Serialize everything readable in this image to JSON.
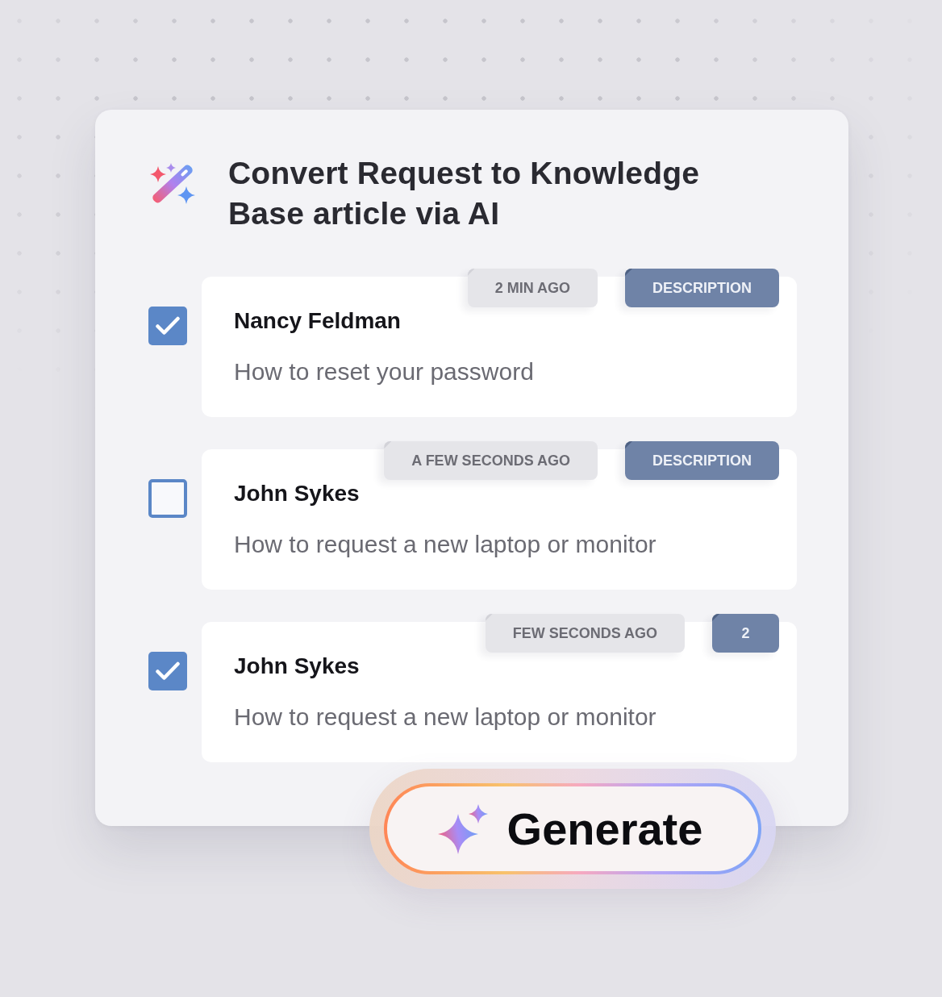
{
  "header": {
    "title": "Convert Request to Knowledge Base article via AI"
  },
  "requests": [
    {
      "checked": true,
      "name": "Nancy Feldman",
      "summary": "How to reset your password",
      "badges": [
        {
          "kind": "time",
          "text": "2 MIN AGO"
        },
        {
          "kind": "field",
          "text": "DESCRIPTION"
        }
      ]
    },
    {
      "checked": false,
      "name": "John Sykes",
      "summary": "How to request a new laptop or monitor",
      "badges": [
        {
          "kind": "time",
          "text": "A FEW SECONDS AGO"
        },
        {
          "kind": "field",
          "text": "DESCRIPTION"
        }
      ]
    },
    {
      "checked": true,
      "name": "John Sykes",
      "summary": "How to request a new laptop or monitor",
      "badges": [
        {
          "kind": "time",
          "text": "FEW SECONDS AGO"
        },
        {
          "kind": "count",
          "text": "2"
        }
      ]
    }
  ],
  "generate_button": {
    "label": "Generate"
  }
}
